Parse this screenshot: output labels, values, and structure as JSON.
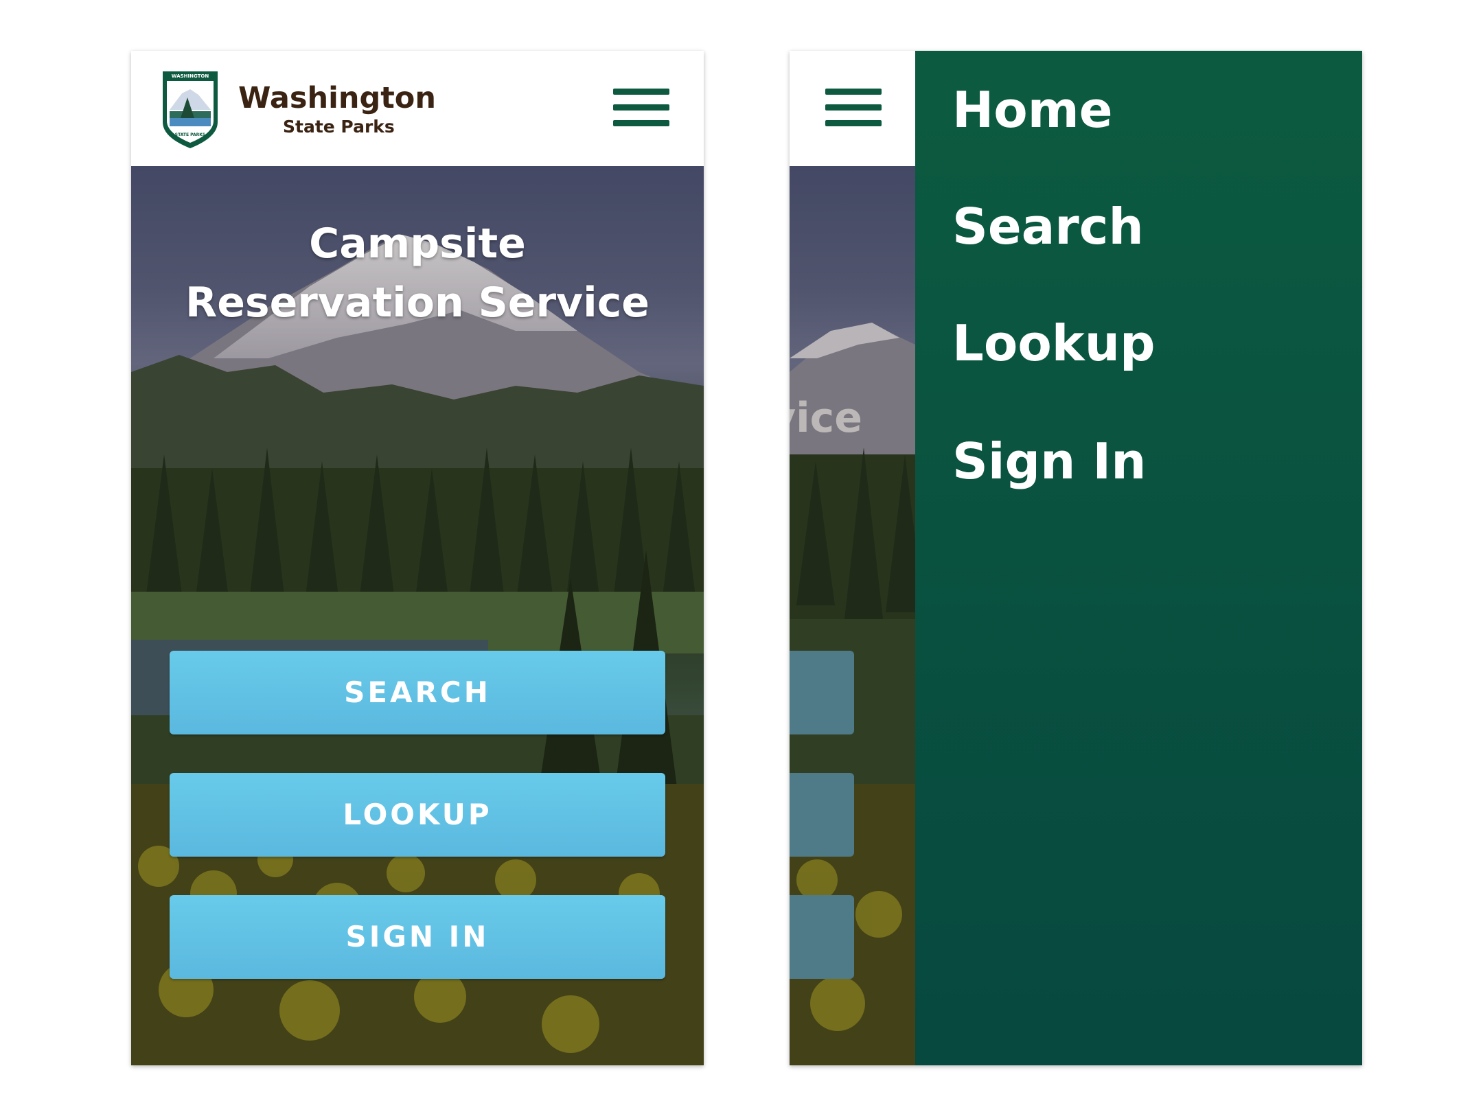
{
  "brand": {
    "title": "Washington",
    "subtitle": "State Parks",
    "badge_top_text": "WASHINGTON",
    "badge_bottom_text": "STATE PARKS"
  },
  "hero": {
    "title_line1": "Campsite",
    "title_line2": "Reservation Service",
    "peek_text": "vice"
  },
  "actions": {
    "search_label": "SEARCH",
    "lookup_label": "LOOKUP",
    "signin_label": "SIGN IN"
  },
  "drawer": {
    "items": [
      {
        "label": "Home"
      },
      {
        "label": "Search"
      },
      {
        "label": "Lookup"
      },
      {
        "label": "Sign In"
      }
    ]
  },
  "icons": {
    "menu": "hamburger-menu-icon",
    "logo": "state-parks-shield-logo"
  },
  "colors": {
    "brand_green": "#0d5a40",
    "brand_brown": "#3a2312",
    "button_blue": "#62c2e6",
    "drawer_green": "#07483f"
  }
}
